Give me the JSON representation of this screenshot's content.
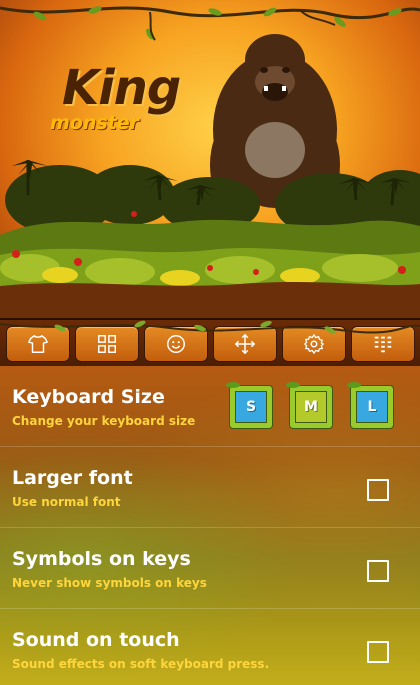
{
  "hero": {
    "logo_title": "King",
    "logo_subtitle": "monster"
  },
  "toolbar": {
    "buttons": [
      {
        "icon": "tshirt-icon"
      },
      {
        "icon": "grid-icon"
      },
      {
        "icon": "smiley-icon"
      },
      {
        "icon": "move-arrows-icon"
      },
      {
        "icon": "gear-icon"
      },
      {
        "icon": "keypad-icon"
      }
    ]
  },
  "settings": {
    "keyboard_size": {
      "title": "Keyboard Size",
      "subtitle": "Change your keyboard size",
      "options": [
        {
          "label": "S",
          "color": "#38a9e0"
        },
        {
          "label": "M",
          "color": "#b4c92a"
        },
        {
          "label": "L",
          "color": "#38a9e0"
        }
      ]
    },
    "larger_font": {
      "title": "Larger font",
      "subtitle": "Use normal font",
      "checked": false
    },
    "symbols_on_keys": {
      "title": "Symbols on keys",
      "subtitle": "Never show symbols on keys",
      "checked": false
    },
    "sound_on_touch": {
      "title": "Sound on touch",
      "subtitle": "Sound effects on soft keyboard press.",
      "checked": false
    }
  },
  "colors": {
    "subtitle": "#ffd53c",
    "toolbar_button": "#d9771a",
    "bamboo": "#9acb2c"
  }
}
